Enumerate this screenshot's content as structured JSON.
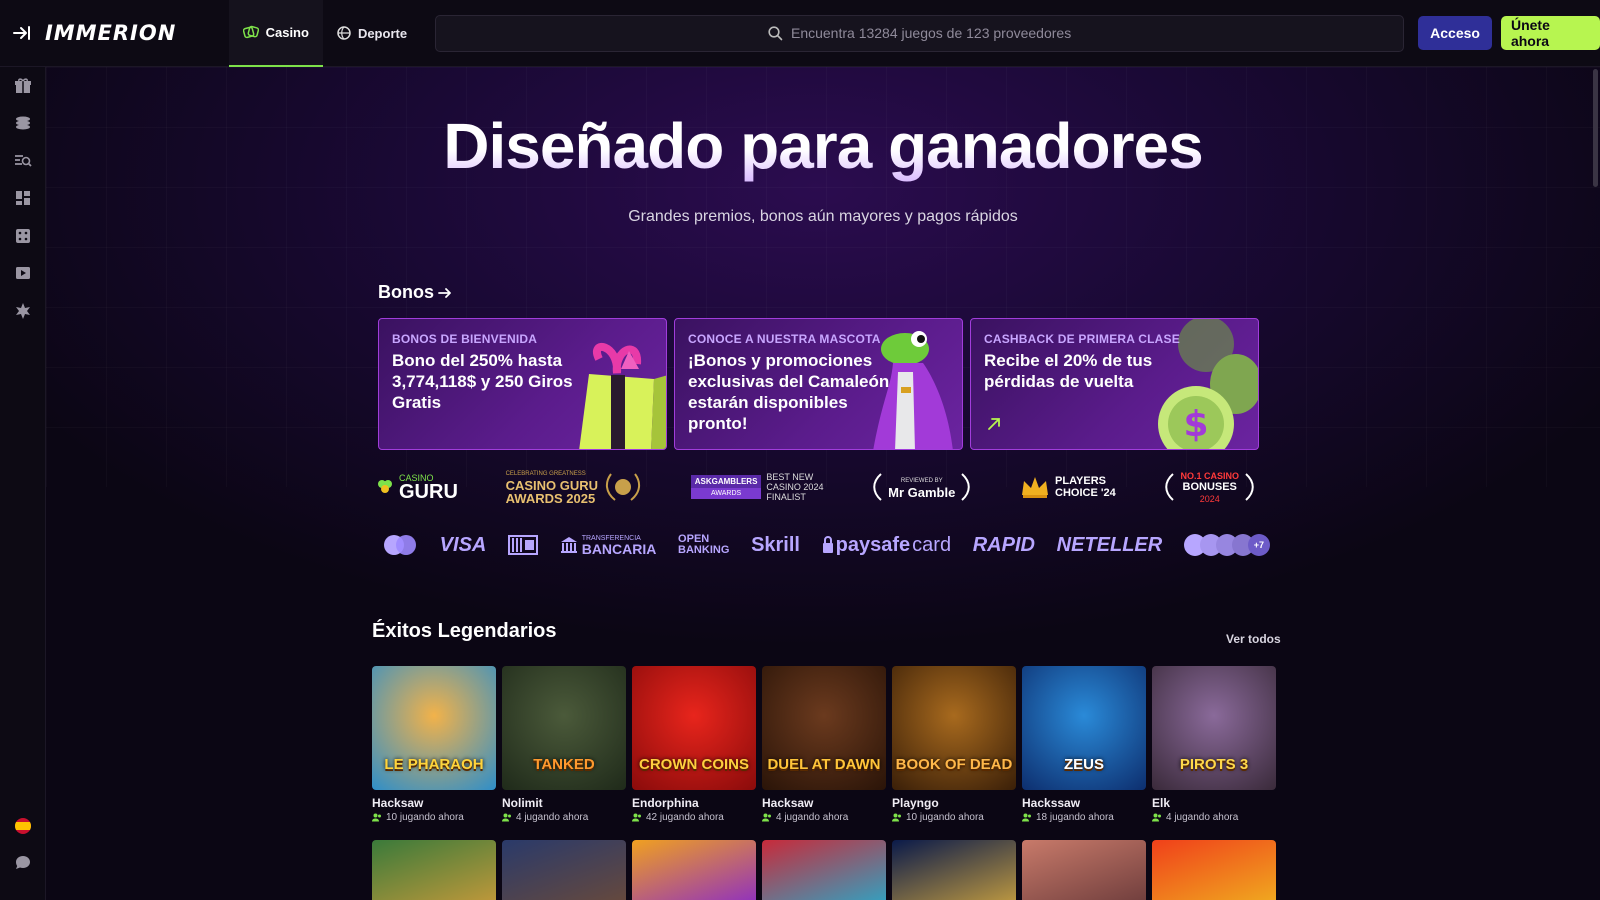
{
  "header": {
    "logo": "IMMERION",
    "tabs": [
      {
        "label": "Casino",
        "active": true
      },
      {
        "label": "Deporte",
        "active": false
      }
    ],
    "search_placeholder": "Encuentra 13284 juegos de 123 proveedores",
    "login_label": "Acceso",
    "join_label": "Únete ahora"
  },
  "sidebar": {
    "icons": [
      "gift-icon",
      "coins-icon",
      "search-list-icon",
      "grid-icon",
      "dice-icon",
      "play-icon",
      "star-icon",
      "spain-flag-icon",
      "chat-icon"
    ]
  },
  "hero": {
    "title": "Diseñado para ganadores",
    "subtitle": "Grandes premios, bonos aún mayores y pagos rápidos"
  },
  "bonos": {
    "heading": "Bonos",
    "cards": [
      {
        "kicker": "BONOS DE BIENVENIDA",
        "text": "Bono del 250% hasta 3,774,118$ y 250 Giros Gratis"
      },
      {
        "kicker": "CONOCE A NUESTRA MASCOTA",
        "text": "¡Bonos y promociones exclusivas del Camaleón estarán disponibles pronto!"
      },
      {
        "kicker": "CASHBACK DE PRIMERA CLASE",
        "text": "Recibe el 20% de tus pérdidas de vuelta"
      }
    ]
  },
  "awards": {
    "casino_guru": {
      "small": "CASINO",
      "big": "GURU"
    },
    "cg_awards": {
      "small": "CELEBRATING GREATNESS",
      "line1": "CASINO GURU",
      "line2": "AWARDS 2025"
    },
    "askgamblers": {
      "badge1": "ASKGAMBLERS",
      "badge2": "AWARDS",
      "text1": "BEST NEW",
      "text2": "CASINO 2024",
      "text3": "FINALIST"
    },
    "mr_gamble": {
      "small": "REVIEWED BY",
      "big": "Mr Gamble"
    },
    "players_choice": {
      "line1": "PLAYERS",
      "line2": "CHOICE '24"
    },
    "no1_bonuses": {
      "line1": "NO.1 CASINO",
      "line2": "BONUSES",
      "line3": "2024"
    }
  },
  "payments": {
    "visa": "VISA",
    "transfer_small": "TRANSFERENCIA",
    "transfer_big": "BANCARIA",
    "open1": "OPEN",
    "open2": "BANKING",
    "skrill": "Skrill",
    "paysafe_bold": "paysafe",
    "paysafe_light": "card",
    "rapid": "RAPID",
    "neteller": "NETELLER",
    "more": "+7"
  },
  "legendarios": {
    "heading": "Éxitos Legendarios",
    "see_all": "Ver todos",
    "games": [
      {
        "provider": "Hacksaw",
        "playing": "10 jugando ahora",
        "thumb_title": "LE PHARAOH",
        "bg1": "#f2b24a",
        "bg2": "#2e8ec9",
        "text_color": "#ffd43b"
      },
      {
        "provider": "Nolimit",
        "playing": "4 jugando ahora",
        "thumb_title": "TANKED",
        "bg1": "#4b5a3a",
        "bg2": "#1f2a1a",
        "text_color": "#ff9a2e"
      },
      {
        "provider": "Endorphina",
        "playing": "42 jugando ahora",
        "thumb_title": "CROWN COINS",
        "bg1": "#e8251c",
        "bg2": "#8a0b0b",
        "text_color": "#ffcf3f"
      },
      {
        "provider": "Hacksaw",
        "playing": "4 jugando ahora",
        "thumb_title": "DUEL AT DAWN",
        "bg1": "#6b3a1e",
        "bg2": "#2a1408",
        "text_color": "#ffc53a"
      },
      {
        "provider": "Playngo",
        "playing": "10 jugando ahora",
        "thumb_title": "BOOK OF DEAD",
        "bg1": "#a86a1e",
        "bg2": "#3a1f08",
        "text_color": "#ffb84a"
      },
      {
        "provider": "Hackssaw",
        "playing": "18 jugando ahora",
        "thumb_title": "ZEUS",
        "bg1": "#2a8ad8",
        "bg2": "#0d2e6e",
        "text_color": "#ffffff"
      },
      {
        "provider": "Elk",
        "playing": "4 jugando ahora",
        "thumb_title": "PIROTS 3",
        "bg1": "#8a6a9a",
        "bg2": "#3a2a3a",
        "text_color": "#ffd84a"
      }
    ]
  },
  "row2_colors": [
    [
      "#3a7a3a",
      "#c89a3a"
    ],
    [
      "#2a3a6a",
      "#6a4a3a"
    ],
    [
      "#f0a020",
      "#8a2ac8"
    ],
    [
      "#c82a3a",
      "#2aa8c8"
    ],
    [
      "#0a1a4a",
      "#c8a040"
    ],
    [
      "#c87a6a",
      "#6a3a3a"
    ],
    [
      "#f0401a",
      "#f0b020"
    ]
  ]
}
